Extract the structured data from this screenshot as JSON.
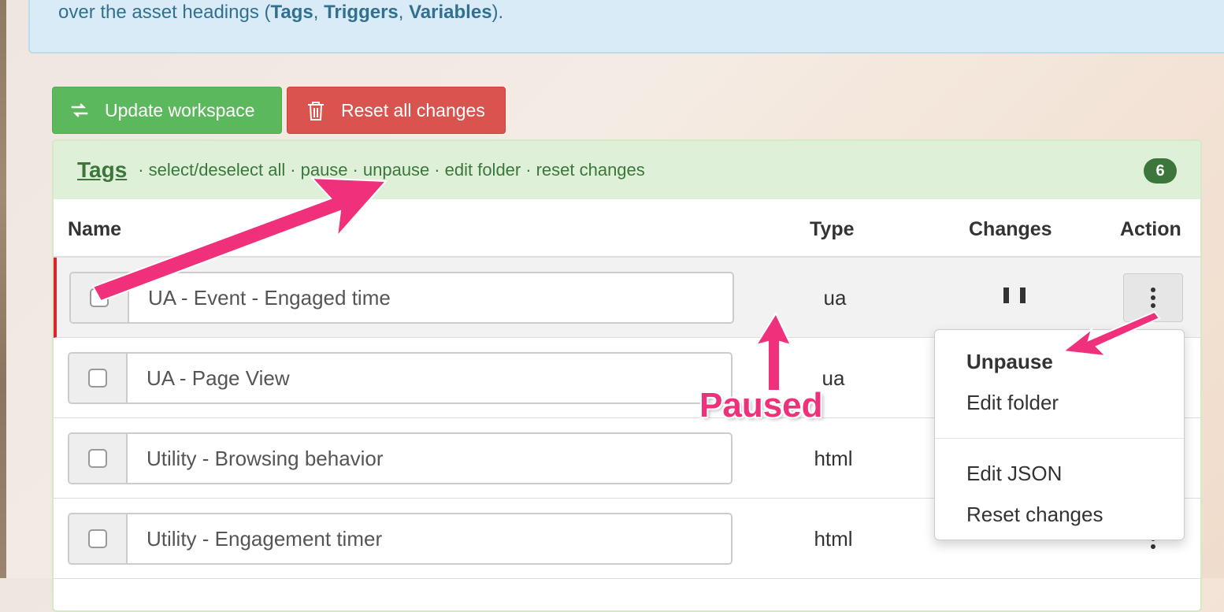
{
  "banner": {
    "prefix": "over the asset headings (",
    "tags": "Tags",
    "comma1": ", ",
    "triggers": "Triggers",
    "comma2": ", ",
    "variables": "Variables",
    "suffix": ")."
  },
  "toolbar": {
    "update_label": "Update workspace",
    "reset_label": "Reset all changes"
  },
  "panel": {
    "title": "Tags",
    "links": [
      "select/deselect all",
      "pause",
      "unpause",
      "edit folder",
      "reset changes"
    ],
    "separator": "·",
    "count": "6"
  },
  "table": {
    "headers": {
      "name": "Name",
      "type": "Type",
      "changes": "Changes",
      "action": "Action"
    },
    "rows": [
      {
        "name": "UA - Event - Engaged time",
        "type": "ua"
      },
      {
        "name": "UA - Page View",
        "type": "ua"
      },
      {
        "name": "Utility - Browsing behavior",
        "type": "html"
      },
      {
        "name": "Utility - Engagement timer",
        "type": "html"
      }
    ]
  },
  "menu": {
    "items": [
      "Unpause",
      "Edit folder",
      "Edit JSON",
      "Reset changes"
    ]
  },
  "annotation": {
    "label": "Paused",
    "color": "#f0307a"
  },
  "colors": {
    "success": "#5cb85c",
    "danger": "#d9534f",
    "panel_header": "#dff0d8",
    "panel_text": "#3c763d",
    "paused_marker": "#e0222f"
  }
}
